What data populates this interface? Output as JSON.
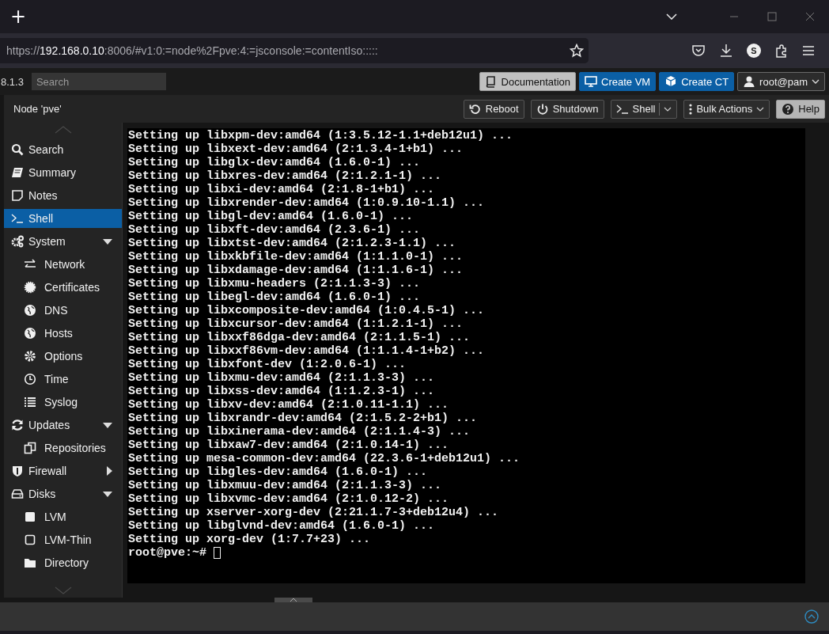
{
  "browser": {
    "new_tab": "+",
    "url": {
      "scheme": "https://",
      "host": "192.168.0.10",
      "rest": ":8006/#v1:0:=node%2Fpve:4:=jsconsole:=contentIso:::::"
    },
    "profile_initial": "S"
  },
  "header": {
    "version": "8.1.3",
    "search": {
      "placeholder": "Search"
    },
    "buttons": [
      {
        "label": "Documentation",
        "kind": "doc"
      },
      {
        "label": "Create VM",
        "kind": "vm"
      },
      {
        "label": "Create CT",
        "kind": "ct"
      },
      {
        "label": "root@pam",
        "kind": "user"
      }
    ]
  },
  "toolbar": {
    "title": "Node 'pve'",
    "buttons": [
      {
        "label": "Reboot",
        "kind": "reboot"
      },
      {
        "label": "Shutdown",
        "kind": "shutdown"
      },
      {
        "label": "Shell",
        "kind": "split"
      },
      {
        "label": "Bulk Actions",
        "kind": "menu"
      },
      {
        "label": "Help",
        "kind": "help"
      }
    ]
  },
  "sidebar": {
    "items": [
      {
        "label": "Search",
        "kind": "search",
        "selected": false
      },
      {
        "label": "Summary",
        "kind": "book",
        "selected": false
      },
      {
        "label": "Notes",
        "kind": "note",
        "selected": false
      },
      {
        "label": "Shell",
        "kind": "terminal",
        "selected": true
      },
      {
        "label": "System",
        "kind": "gears",
        "selected": false,
        "expanded": true,
        "children": [
          {
            "label": "Network",
            "kind": "exchange",
            "selected": false
          },
          {
            "label": "Certificates",
            "kind": "cert",
            "selected": false
          },
          {
            "label": "DNS",
            "kind": "globe",
            "selected": false
          },
          {
            "label": "Hosts",
            "kind": "globe",
            "selected": false
          },
          {
            "label": "Options",
            "kind": "gear",
            "selected": false
          },
          {
            "label": "Time",
            "kind": "clock",
            "selected": false
          },
          {
            "label": "Syslog",
            "kind": "list",
            "selected": false
          }
        ]
      },
      {
        "label": "Updates",
        "kind": "refresh",
        "selected": false,
        "expanded": true,
        "children": [
          {
            "label": "Repositories",
            "kind": "files",
            "selected": false
          }
        ]
      },
      {
        "label": "Firewall",
        "kind": "shield",
        "selected": false,
        "expanded": false
      },
      {
        "label": "Disks",
        "kind": "drive",
        "selected": false,
        "expanded": true,
        "children": [
          {
            "label": "LVM",
            "kind": "square",
            "selected": false
          },
          {
            "label": "LVM-Thin",
            "kind": "outline",
            "selected": false
          },
          {
            "label": "Directory",
            "kind": "folder",
            "selected": false
          }
        ]
      }
    ]
  },
  "terminal": {
    "lines": [
      "Setting up libxpm-dev:amd64 (1:3.5.12-1.1+deb12u1) ...",
      "Setting up libxext-dev:amd64 (2:1.3.4-1+b1) ...",
      "Setting up libglx-dev:amd64 (1.6.0-1) ...",
      "Setting up libxres-dev:amd64 (2:1.2.1-1) ...",
      "Setting up libxi-dev:amd64 (2:1.8-1+b1) ...",
      "Setting up libxrender-dev:amd64 (1:0.9.10-1.1) ...",
      "Setting up libgl-dev:amd64 (1.6.0-1) ...",
      "Setting up libxft-dev:amd64 (2.3.6-1) ...",
      "Setting up libxtst-dev:amd64 (2:1.2.3-1.1) ...",
      "Setting up libxkbfile-dev:amd64 (1:1.1.0-1) ...",
      "Setting up libxdamage-dev:amd64 (1:1.1.6-1) ...",
      "Setting up libxmu-headers (2:1.1.3-3) ...",
      "Setting up libegl-dev:amd64 (1.6.0-1) ...",
      "Setting up libxcomposite-dev:amd64 (1:0.4.5-1) ...",
      "Setting up libxcursor-dev:amd64 (1:1.2.1-1) ...",
      "Setting up libxxf86dga-dev:amd64 (2:1.1.5-1) ...",
      "Setting up libxxf86vm-dev:amd64 (1:1.1.4-1+b2) ...",
      "Setting up libxfont-dev (1:2.0.6-1) ...",
      "Setting up libxmu-dev:amd64 (2:1.1.3-3) ...",
      "Setting up libxss-dev:amd64 (1:1.2.3-1) ...",
      "Setting up libxv-dev:amd64 (2:1.0.11-1.1) ...",
      "Setting up libxrandr-dev:amd64 (2:1.5.2-2+b1) ...",
      "Setting up libxinerama-dev:amd64 (2:1.1.4-3) ...",
      "Setting up libxaw7-dev:amd64 (2:1.0.14-1) ...",
      "Setting up mesa-common-dev:amd64 (22.3.6-1+deb12u1) ...",
      "Setting up libgles-dev:amd64 (1.6.0-1) ...",
      "Setting up libxmuu-dev:amd64 (2:1.1.3-3) ...",
      "Setting up libxvmc-dev:amd64 (2:1.0.12-2) ...",
      "Setting up xserver-xorg-dev (2:21.1.7-3+deb12u4) ...",
      "Setting up libglvnd-dev:amd64 (1.6.0-1) ...",
      "Setting up xorg-dev (1:7.7+23) ..."
    ],
    "prompt": "root@pve:~#"
  }
}
